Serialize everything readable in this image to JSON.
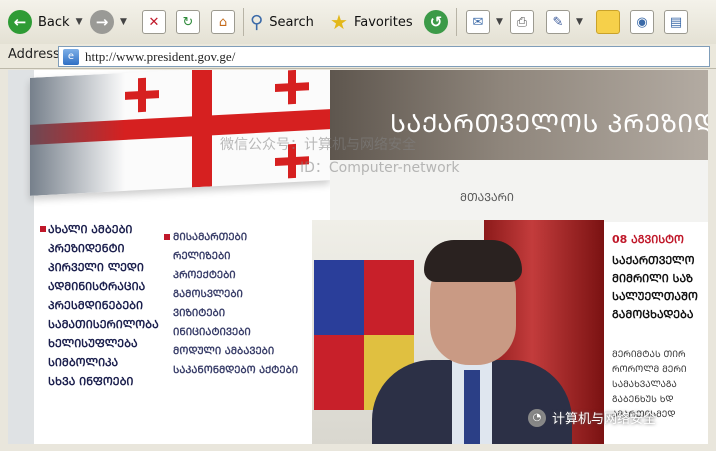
{
  "toolbar": {
    "back_label": "Back",
    "search_label": "Search",
    "favorites_label": "Favorites"
  },
  "address": {
    "label": "Address",
    "value": "http://www.president.gov.ge/"
  },
  "site": {
    "header_title": "ᲡᲐᲥᲐᲠᲗᲕᲔᲚᲝᲡ ᲞᲠᲔᲖᲘᲓᲔᲜ",
    "sub_label": "ᲛᲗᲐᲕᲐᲠᲘ",
    "nav_primary": [
      "ᲐᲮᲐᲚᲘ ᲐᲛᲑᲔᲑᲘ",
      "ᲞᲠᲔᲖᲘᲓᲔᲜᲢᲘ",
      "ᲞᲘᲠᲕᲔᲚᲘ ᲚᲔᲓᲘ",
      "ᲐᲓᲛᲘᲜᲘᲡᲢᲠᲐᲪᲘᲐ",
      "ᲞᲠᲔᲡᲛᲓᲘᲜᲔᲑᲔᲑᲘ",
      "ᲡᲐᲛᲐᲗᲘᲡᲔᲠᲘᲚᲝᲑᲐ",
      "ᲮᲔᲚᲘᲡᲣᲤᲚᲔᲑᲐ",
      "ᲡᲘᲛᲑᲝᲚᲘᲙᲐ",
      "ᲡᲮᲕᲐ ᲘᲜᲤᲝᲔᲑᲘ"
    ],
    "nav_secondary": [
      "ᲛᲘᲡᲐᲛᲐᲠᲗᲔᲑᲘ",
      "ᲠᲔᲚᲘᲖᲔᲑᲘ",
      "ᲞᲠᲝᲔᲥᲢᲔᲑᲘ",
      "ᲒᲐᲛᲝᲡᲕᲚᲔᲑᲘ",
      "ᲕᲘᲖᲘᲢᲔᲑᲘ",
      "ᲘᲜᲘᲪᲘᲐᲢᲘᲕᲔᲑᲘ",
      "ᲛᲝᲓᲣᲚᲘ ᲐᲛᲑᲐᲕᲔᲑᲘ",
      "ᲡᲐᲙᲐᲜᲝᲜᲛᲓᲔᲑᲝ ᲐᲥᲢᲔᲑᲘ"
    ],
    "news_date": "08 ᲐᲒᲕᲘᲡᲢᲝ",
    "news_headline": [
      "ᲡᲐᲥᲐᲠᲗᲕᲔᲚᲝ",
      "ᲛᲘᲛᲠᲘᲚᲘ ᲡᲐᲖ",
      "ᲡᲐᲚᲣᲔᲚᲗᲐᲨᲝ",
      "ᲒᲐᲛᲝᲪᲮᲐᲓᲔᲑᲐ"
    ],
    "news_body": [
      "ᲛᲔᲠᲘᲛᲢᲐᲡ ᲗᲘᲠ",
      "ᲠᲝᲠᲝᲚᲛ ᲛᲔᲠᲘ",
      "ᲡᲐᲛᲐᲮᲕᲐᲚᲐᲒᲐ",
      "ᲒᲐᲑᲔᲜᲮᲣᲡ ᲮᲓ",
      "ᲐᲛᲐᲠᲗᲘᲡᲛᲔᲓ"
    ]
  },
  "watermark": {
    "line1": "微信公众号：计算机与网络安全",
    "line2": "ID：Computer-network"
  },
  "badge": {
    "text": "计算机与网络安全"
  },
  "colors": {
    "flag_red": "#d62020",
    "nav_text": "#1b1f4d",
    "news_date": "#c0182a"
  }
}
